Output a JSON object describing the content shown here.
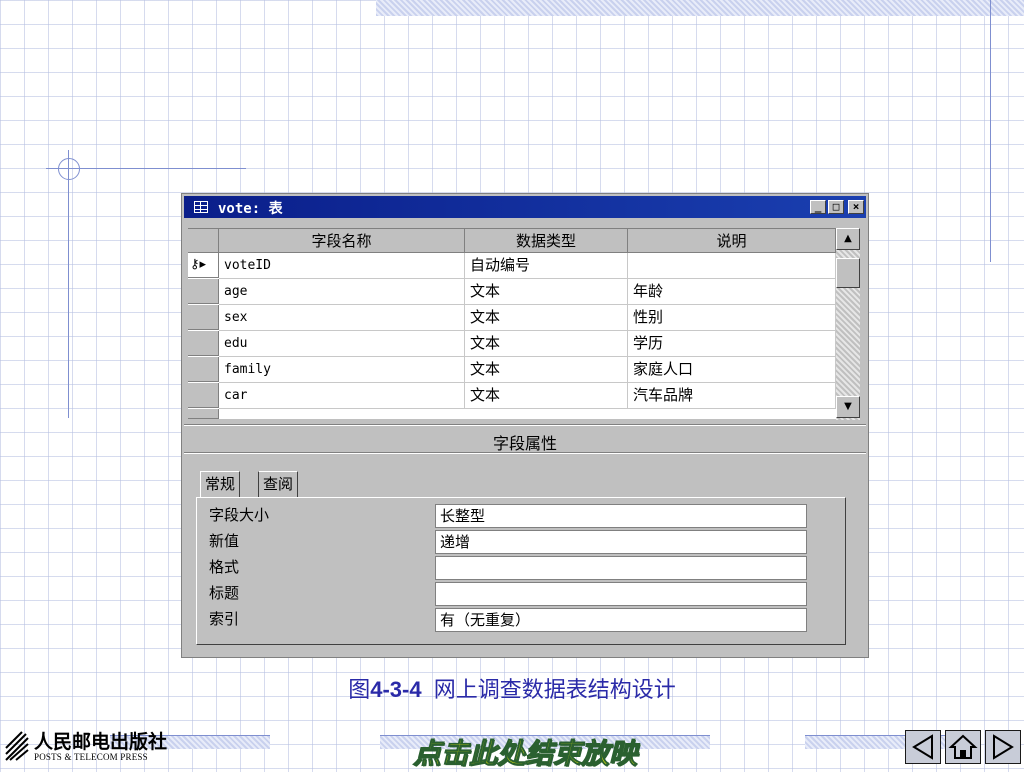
{
  "window": {
    "title": "vote: 表",
    "columns": [
      "字段名称",
      "数据类型",
      "说明"
    ],
    "rows": [
      {
        "name": "voteID",
        "type": "自动编号",
        "desc": "",
        "is_key": true
      },
      {
        "name": "age",
        "type": "文本",
        "desc": "年龄"
      },
      {
        "name": "sex",
        "type": "文本",
        "desc": "性别"
      },
      {
        "name": "edu",
        "type": "文本",
        "desc": "学历"
      },
      {
        "name": "family",
        "type": "文本",
        "desc": "家庭人口"
      },
      {
        "name": "car",
        "type": "文本",
        "desc": "汽车品牌"
      }
    ],
    "field_properties_title": "字段属性",
    "tabs": [
      "常规",
      "查阅"
    ],
    "properties": [
      {
        "label": "字段大小",
        "value": "长整型"
      },
      {
        "label": "新值",
        "value": "递增"
      },
      {
        "label": "格式",
        "value": ""
      },
      {
        "label": "标题",
        "value": ""
      },
      {
        "label": "索引",
        "value": "有（无重复）"
      }
    ]
  },
  "caption": {
    "prefix": "图",
    "number": "4-3-4",
    "text": "网上调查数据表结构设计"
  },
  "footer": {
    "publisher": "人民邮电出版社",
    "publisher_en": "POSTS & TELECOM PRESS",
    "end_show": "点击此处结束放映"
  },
  "icons": [
    "table-icon",
    "minimize-icon",
    "maximize-icon",
    "close-icon",
    "primary-key-icon",
    "scroll-up-icon",
    "scroll-down-icon",
    "prev-icon",
    "home-icon",
    "next-icon"
  ]
}
